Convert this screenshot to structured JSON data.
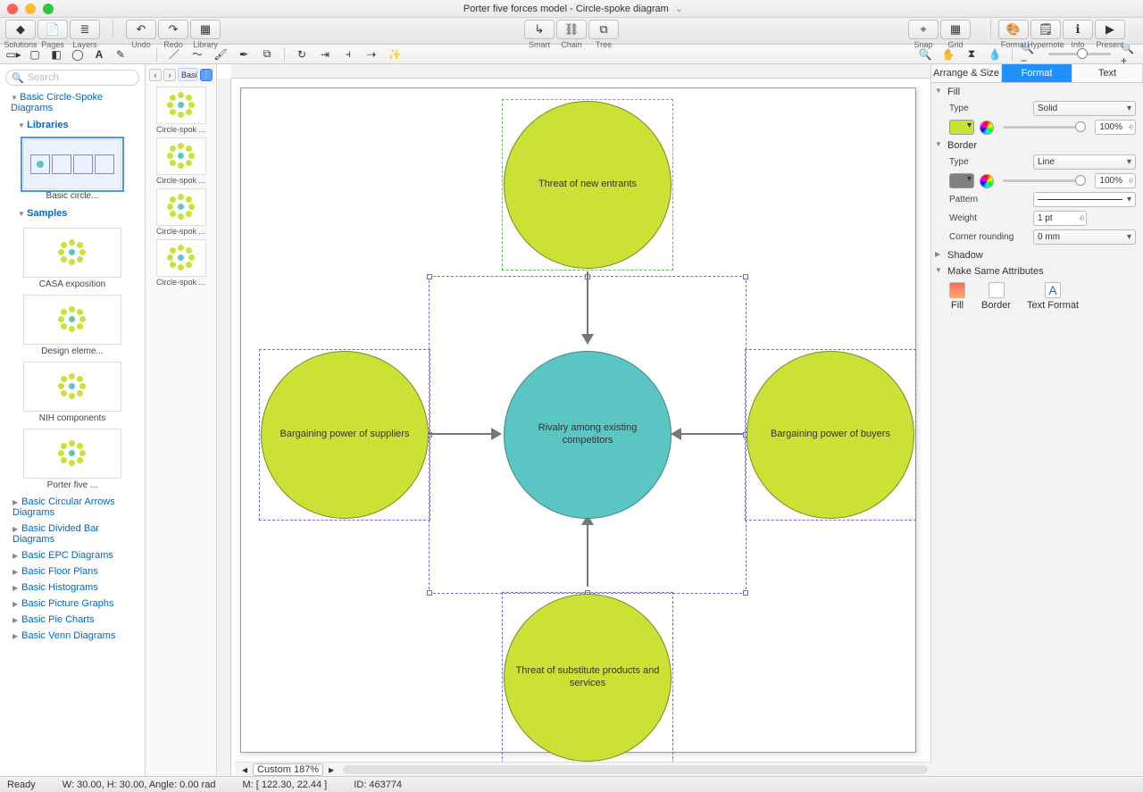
{
  "window": {
    "title": "Porter five forces model - Circle-spoke diagram"
  },
  "toolbar": {
    "left": [
      {
        "id": "solutions-button",
        "icon": "◆",
        "label": "Solutions"
      },
      {
        "id": "pages-button",
        "icon": "📄",
        "label": "Pages"
      },
      {
        "id": "layers-button",
        "icon": "≣",
        "label": "Layers"
      }
    ],
    "history": [
      {
        "id": "undo-button",
        "icon": "↶",
        "label": "Undo"
      },
      {
        "id": "redo-button",
        "icon": "↷",
        "label": "Redo"
      },
      {
        "id": "library-button",
        "icon": "▦",
        "label": "Library"
      }
    ],
    "center": [
      {
        "id": "smart-button",
        "icon": "↳",
        "label": "Smart"
      },
      {
        "id": "chain-button",
        "icon": "⛓",
        "label": "Chain"
      },
      {
        "id": "tree-button",
        "icon": "⧉",
        "label": "Tree"
      }
    ],
    "right1": [
      {
        "id": "snap-button",
        "icon": "⌖",
        "label": "Snap"
      },
      {
        "id": "grid-button",
        "icon": "▦",
        "label": "Grid"
      }
    ],
    "right2": [
      {
        "id": "format-button",
        "icon": "🎨",
        "label": "Format"
      },
      {
        "id": "hypernote-button",
        "icon": "🗒",
        "label": "Hypernote"
      },
      {
        "id": "info-button",
        "icon": "ℹ",
        "label": "Info"
      },
      {
        "id": "present-button",
        "icon": "▶",
        "label": "Present"
      }
    ]
  },
  "left_panel": {
    "search_placeholder": "Search",
    "active_category": "Basic Circle-Spoke Diagrams",
    "libraries_header": "Libraries",
    "samples_header": "Samples",
    "library_thumbs": [
      {
        "label": "Basic circle..."
      }
    ],
    "sample_thumbs": [
      {
        "label": "CASA exposition"
      },
      {
        "label": "Design eleme..."
      },
      {
        "label": "NIH components"
      },
      {
        "label": "Porter five ..."
      }
    ],
    "categories": [
      "Basic Circular Arrows Diagrams",
      "Basic Divided Bar Diagrams",
      "Basic EPC Diagrams",
      "Basic Floor Plans",
      "Basic Histograms",
      "Basic Picture Graphs",
      "Basic Pie Charts",
      "Basic Venn Diagrams"
    ]
  },
  "lib_panel": {
    "crumb": "Basic...",
    "items": [
      {
        "label": "Circle-spok ..."
      },
      {
        "label": "Circle-spok ..."
      },
      {
        "label": "Circle-spok ..."
      },
      {
        "label": "Circle-spok ..."
      }
    ]
  },
  "canvas": {
    "nodes": {
      "center": "Rivalry among existing competitors",
      "top": "Threat of new entrants",
      "left": "Bargaining power of suppliers",
      "right": "Bargaining power of buyers",
      "bottom": "Threat of substitute products and services"
    },
    "colors": {
      "spoke": "#c9e235",
      "hub": "#5bc5c3"
    },
    "zoom_label": "Custom 187%"
  },
  "inspector": {
    "tabs": [
      "Arrange & Size",
      "Format",
      "Text"
    ],
    "active_tab": 1,
    "fill": {
      "section": "Fill",
      "type_label": "Type",
      "type": "Solid",
      "opacity": "100%",
      "swatch": "#c9e235"
    },
    "border": {
      "section": "Border",
      "type_label": "Type",
      "type": "Line",
      "opacity": "100%",
      "swatch": "#808080",
      "pattern_label": "Pattern",
      "weight_label": "Weight",
      "weight": "1 pt",
      "corner_label": "Corner rounding",
      "corner": "0 mm"
    },
    "shadow_section": "Shadow",
    "msa_section": "Make Same Attributes",
    "msa": [
      "Fill",
      "Border",
      "Text Format"
    ]
  },
  "status": {
    "ready": "Ready",
    "wh": "W: 30.00,  H: 30.00,  Angle: 0.00 rad",
    "mouse": "M: [ 122.30, 22.44 ]",
    "id": "ID: 463774"
  }
}
